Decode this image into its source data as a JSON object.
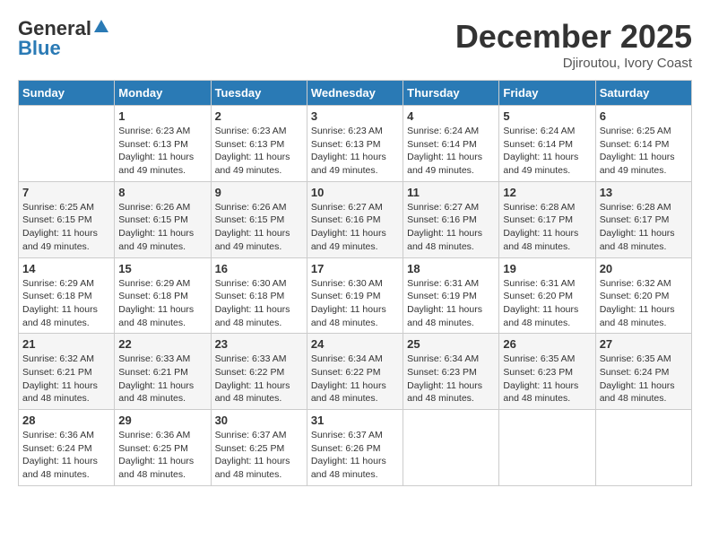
{
  "logo": {
    "general": "General",
    "blue": "Blue"
  },
  "title": "December 2025",
  "location": "Djiroutou, Ivory Coast",
  "days_of_week": [
    "Sunday",
    "Monday",
    "Tuesday",
    "Wednesday",
    "Thursday",
    "Friday",
    "Saturday"
  ],
  "weeks": [
    [
      {
        "day": "",
        "sunrise": "",
        "sunset": "",
        "daylight": ""
      },
      {
        "day": "1",
        "sunrise": "Sunrise: 6:23 AM",
        "sunset": "Sunset: 6:13 PM",
        "daylight": "Daylight: 11 hours and 49 minutes."
      },
      {
        "day": "2",
        "sunrise": "Sunrise: 6:23 AM",
        "sunset": "Sunset: 6:13 PM",
        "daylight": "Daylight: 11 hours and 49 minutes."
      },
      {
        "day": "3",
        "sunrise": "Sunrise: 6:23 AM",
        "sunset": "Sunset: 6:13 PM",
        "daylight": "Daylight: 11 hours and 49 minutes."
      },
      {
        "day": "4",
        "sunrise": "Sunrise: 6:24 AM",
        "sunset": "Sunset: 6:14 PM",
        "daylight": "Daylight: 11 hours and 49 minutes."
      },
      {
        "day": "5",
        "sunrise": "Sunrise: 6:24 AM",
        "sunset": "Sunset: 6:14 PM",
        "daylight": "Daylight: 11 hours and 49 minutes."
      },
      {
        "day": "6",
        "sunrise": "Sunrise: 6:25 AM",
        "sunset": "Sunset: 6:14 PM",
        "daylight": "Daylight: 11 hours and 49 minutes."
      }
    ],
    [
      {
        "day": "7",
        "sunrise": "Sunrise: 6:25 AM",
        "sunset": "Sunset: 6:15 PM",
        "daylight": "Daylight: 11 hours and 49 minutes."
      },
      {
        "day": "8",
        "sunrise": "Sunrise: 6:26 AM",
        "sunset": "Sunset: 6:15 PM",
        "daylight": "Daylight: 11 hours and 49 minutes."
      },
      {
        "day": "9",
        "sunrise": "Sunrise: 6:26 AM",
        "sunset": "Sunset: 6:15 PM",
        "daylight": "Daylight: 11 hours and 49 minutes."
      },
      {
        "day": "10",
        "sunrise": "Sunrise: 6:27 AM",
        "sunset": "Sunset: 6:16 PM",
        "daylight": "Daylight: 11 hours and 49 minutes."
      },
      {
        "day": "11",
        "sunrise": "Sunrise: 6:27 AM",
        "sunset": "Sunset: 6:16 PM",
        "daylight": "Daylight: 11 hours and 48 minutes."
      },
      {
        "day": "12",
        "sunrise": "Sunrise: 6:28 AM",
        "sunset": "Sunset: 6:17 PM",
        "daylight": "Daylight: 11 hours and 48 minutes."
      },
      {
        "day": "13",
        "sunrise": "Sunrise: 6:28 AM",
        "sunset": "Sunset: 6:17 PM",
        "daylight": "Daylight: 11 hours and 48 minutes."
      }
    ],
    [
      {
        "day": "14",
        "sunrise": "Sunrise: 6:29 AM",
        "sunset": "Sunset: 6:18 PM",
        "daylight": "Daylight: 11 hours and 48 minutes."
      },
      {
        "day": "15",
        "sunrise": "Sunrise: 6:29 AM",
        "sunset": "Sunset: 6:18 PM",
        "daylight": "Daylight: 11 hours and 48 minutes."
      },
      {
        "day": "16",
        "sunrise": "Sunrise: 6:30 AM",
        "sunset": "Sunset: 6:18 PM",
        "daylight": "Daylight: 11 hours and 48 minutes."
      },
      {
        "day": "17",
        "sunrise": "Sunrise: 6:30 AM",
        "sunset": "Sunset: 6:19 PM",
        "daylight": "Daylight: 11 hours and 48 minutes."
      },
      {
        "day": "18",
        "sunrise": "Sunrise: 6:31 AM",
        "sunset": "Sunset: 6:19 PM",
        "daylight": "Daylight: 11 hours and 48 minutes."
      },
      {
        "day": "19",
        "sunrise": "Sunrise: 6:31 AM",
        "sunset": "Sunset: 6:20 PM",
        "daylight": "Daylight: 11 hours and 48 minutes."
      },
      {
        "day": "20",
        "sunrise": "Sunrise: 6:32 AM",
        "sunset": "Sunset: 6:20 PM",
        "daylight": "Daylight: 11 hours and 48 minutes."
      }
    ],
    [
      {
        "day": "21",
        "sunrise": "Sunrise: 6:32 AM",
        "sunset": "Sunset: 6:21 PM",
        "daylight": "Daylight: 11 hours and 48 minutes."
      },
      {
        "day": "22",
        "sunrise": "Sunrise: 6:33 AM",
        "sunset": "Sunset: 6:21 PM",
        "daylight": "Daylight: 11 hours and 48 minutes."
      },
      {
        "day": "23",
        "sunrise": "Sunrise: 6:33 AM",
        "sunset": "Sunset: 6:22 PM",
        "daylight": "Daylight: 11 hours and 48 minutes."
      },
      {
        "day": "24",
        "sunrise": "Sunrise: 6:34 AM",
        "sunset": "Sunset: 6:22 PM",
        "daylight": "Daylight: 11 hours and 48 minutes."
      },
      {
        "day": "25",
        "sunrise": "Sunrise: 6:34 AM",
        "sunset": "Sunset: 6:23 PM",
        "daylight": "Daylight: 11 hours and 48 minutes."
      },
      {
        "day": "26",
        "sunrise": "Sunrise: 6:35 AM",
        "sunset": "Sunset: 6:23 PM",
        "daylight": "Daylight: 11 hours and 48 minutes."
      },
      {
        "day": "27",
        "sunrise": "Sunrise: 6:35 AM",
        "sunset": "Sunset: 6:24 PM",
        "daylight": "Daylight: 11 hours and 48 minutes."
      }
    ],
    [
      {
        "day": "28",
        "sunrise": "Sunrise: 6:36 AM",
        "sunset": "Sunset: 6:24 PM",
        "daylight": "Daylight: 11 hours and 48 minutes."
      },
      {
        "day": "29",
        "sunrise": "Sunrise: 6:36 AM",
        "sunset": "Sunset: 6:25 PM",
        "daylight": "Daylight: 11 hours and 48 minutes."
      },
      {
        "day": "30",
        "sunrise": "Sunrise: 6:37 AM",
        "sunset": "Sunset: 6:25 PM",
        "daylight": "Daylight: 11 hours and 48 minutes."
      },
      {
        "day": "31",
        "sunrise": "Sunrise: 6:37 AM",
        "sunset": "Sunset: 6:26 PM",
        "daylight": "Daylight: 11 hours and 48 minutes."
      },
      {
        "day": "",
        "sunrise": "",
        "sunset": "",
        "daylight": ""
      },
      {
        "day": "",
        "sunrise": "",
        "sunset": "",
        "daylight": ""
      },
      {
        "day": "",
        "sunrise": "",
        "sunset": "",
        "daylight": ""
      }
    ]
  ]
}
